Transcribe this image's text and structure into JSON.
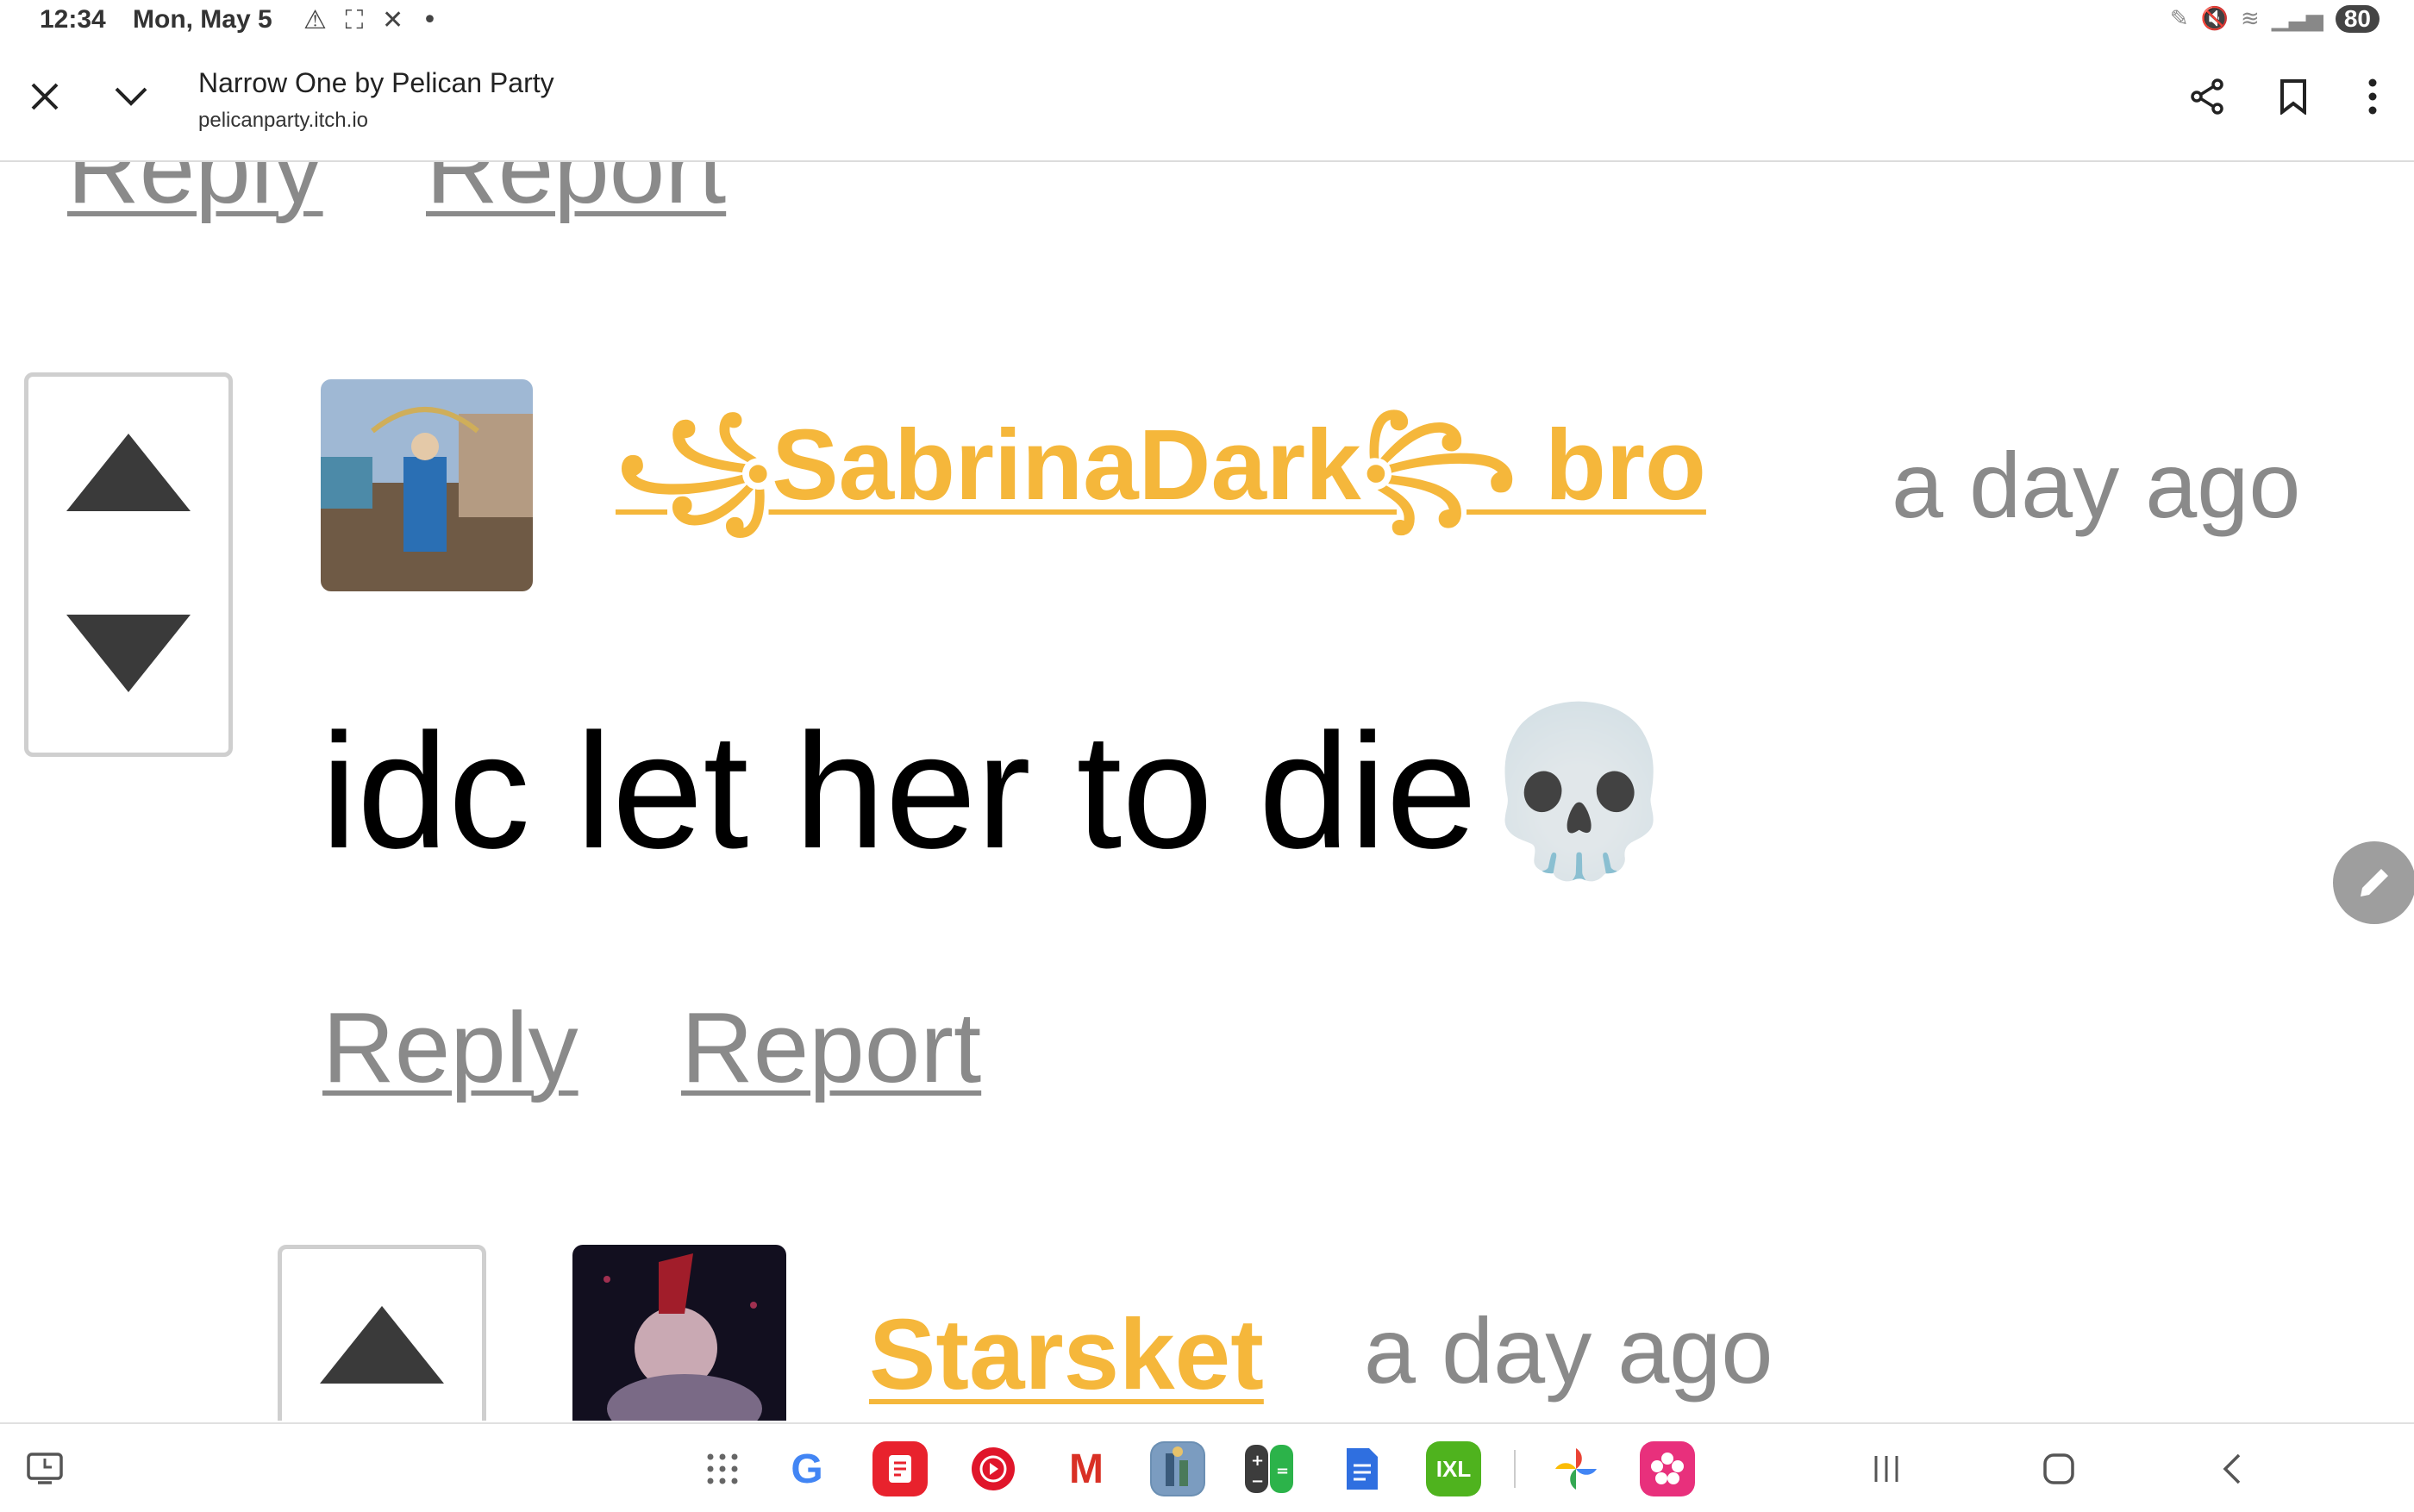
{
  "status_bar": {
    "time": "12:34",
    "date": "Mon, May 5",
    "left_icons": "⚠ ⛶ ✕ •",
    "battery": "80"
  },
  "browser": {
    "title": "Narrow One by Pelican Party",
    "url": "pelicanparty.itch.io",
    "icons": [
      "close-icon",
      "chevron-down-icon",
      "share-icon",
      "bookmark-icon",
      "more-vert-icon"
    ]
  },
  "top_partial_actions": {
    "reply": "Reply",
    "report": "Report"
  },
  "comments": [
    {
      "username": "꧁SabrinaDark꧂ bro",
      "timestamp": "a day ago",
      "body": "idc let her to die💀",
      "reply": "Reply",
      "report": "Report"
    },
    {
      "username": "Starsket",
      "timestamp": "a day ago"
    }
  ],
  "dock": {
    "apps": [
      "apps-grid-icon",
      "google-icon",
      "notes-icon",
      "youtube-music-icon",
      "gmail-icon",
      "game-icon",
      "calculator-icon",
      "docs-icon",
      "ixl-icon",
      "photos-icon",
      "gallery-icon"
    ],
    "ixl_label": "IXL",
    "google_label": "G",
    "gmail_label": "M"
  },
  "colors": {
    "username": "#f5b73b",
    "muted_link": "#8a8a8a",
    "vote_arrow": "#3a3a3a",
    "vote_border": "#cfcfcf"
  }
}
